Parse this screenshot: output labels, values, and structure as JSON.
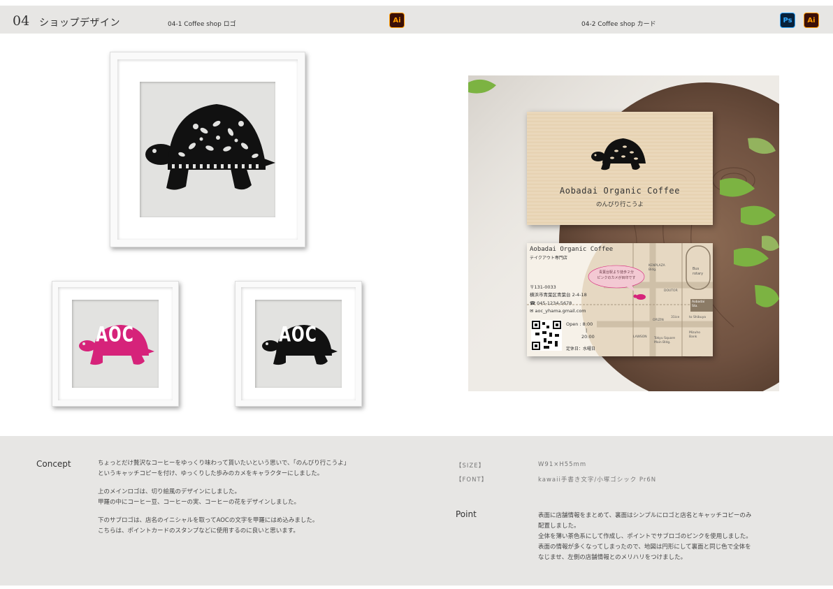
{
  "header": {
    "number": "04",
    "title": "ショップデザイン",
    "sub1": "04-1   Coffee shop ロゴ",
    "sub2": "04-2   Coffee shop カード",
    "icons": [
      "ai-icon",
      "ps-icon",
      "ai-icon"
    ],
    "ai_label": "Ai",
    "ps_label": "Ps"
  },
  "colors": {
    "header_bg": "#e7e6e4",
    "pink": "#d6237a",
    "black": "#111111",
    "kraft": "#e9d6b8"
  },
  "logos": {
    "sub_mark_text": "AOC"
  },
  "card_front": {
    "name": "Aobadai Organic Coffee",
    "catch": "のんびり行こうよ"
  },
  "card_back": {
    "name": "Aobadai Organic Coffee",
    "type": "テイクアウト専門店",
    "bubble_line1": "青葉台駅より徒歩２分",
    "bubble_line2": "ピンクのカメが目印です",
    "postal": "〒131-0033",
    "address": "横浜市青葉区青葉台 2-4-18",
    "tel": "☎ 045-1234-5678",
    "mail": "✉ aoc_yhama.gmail.com",
    "open_label": "Open : 8:00",
    "open_sep": "|",
    "open_end": "20:00",
    "closed": "定休日：水曜日",
    "map": {
      "kenplaza": "KENPLAZA\nBldg.",
      "bus": "Bus\nrotary",
      "doutor": "DOUTOR",
      "station": "Aobadai\nSta.",
      "to_shibuya": "to Shibuya",
      "origin": "ORIZIN",
      "ice": "31ice",
      "lawson": "LAWSON",
      "tokyu": "Tokyu Square\nMain Bldg.",
      "mizuho": "Mizuho\nBank"
    }
  },
  "bottom": {
    "concept_label": "Concept",
    "concept_p1_l1": "ちょっとだけ贅沢なコーヒーをゆっくり味わって貰いたいという思いで、「のんびり行こうよ」",
    "concept_p1_l2": "というキャッチコピーを付け、ゆっくりした歩みのカメをキャラクターにしました。",
    "concept_p2_l1": "上のメインロゴは、切り絵風のデザインにしました。",
    "concept_p2_l2": "甲羅の中にコーヒー豆、コーヒーの実、コーヒーの花をデザインしました。",
    "concept_p3_l1": "下のサブロゴは、店名のイニシャルを取ってAOCの文字を甲羅にはめ込みました。",
    "concept_p3_l2": "こちらは、ポイントカードのスタンプなどに使用するのに良いと思います。",
    "size_label": "【SIZE】",
    "size_value": "W91×H55mm",
    "font_label": "【FONT】",
    "font_value": "kawaii手書き文字/小塚ゴシック Pr6N",
    "point_label": "Point",
    "point_l1": "表面に店舗情報をまとめて、裏面はシンプルにロゴと店名とキャッチコピーのみ",
    "point_l2": "配置しました。",
    "point_l3": "全体を薄い茶色系にして作成し、ポイントでサブロゴのピンクを使用しました。",
    "point_l4": "表面の情報が多くなってしまったので、地図は円形にして裏面と同じ色で全体を",
    "point_l5": "なじませ、左側の店舗情報とのメリハリをつけました。"
  }
}
